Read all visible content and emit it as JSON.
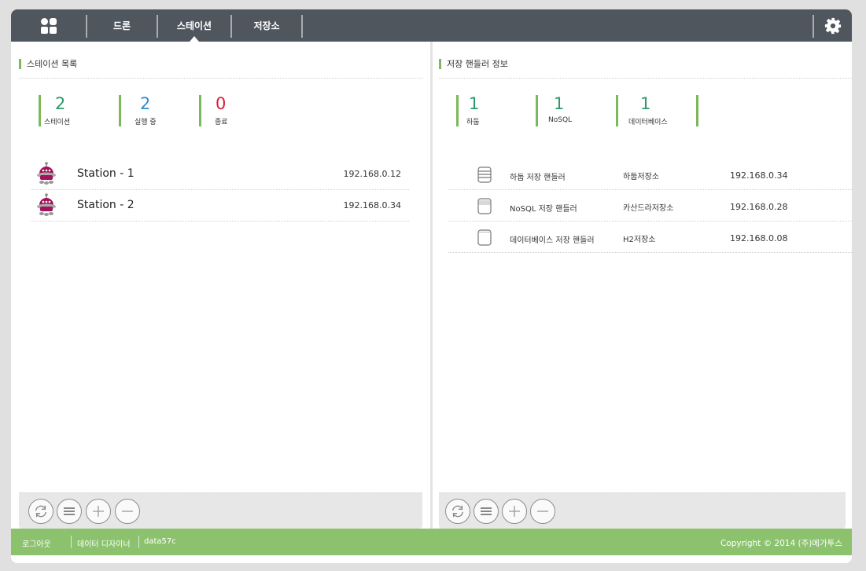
{
  "nav": {
    "home_icon": "grid-icon",
    "tabs": [
      {
        "label": "드론",
        "active": false
      },
      {
        "label": "스테이션",
        "active": true
      },
      {
        "label": "저장소",
        "active": false
      }
    ],
    "settings_icon": "gear-icon"
  },
  "left_panel": {
    "title": "스테이션 목록",
    "stats": [
      {
        "value": "2",
        "label": "스테이션",
        "color": "#2e9a6a"
      },
      {
        "value": "2",
        "label": "실행 중",
        "color": "#2a8fd6"
      },
      {
        "value": "0",
        "label": "종료",
        "color": "#d4203c"
      }
    ],
    "stations": [
      {
        "name": "Station - 1",
        "ip": "192.168.0.12",
        "icon": "robot-icon"
      },
      {
        "name": "Station - 2",
        "ip": "192.168.0.34",
        "icon": "robot-icon"
      }
    ]
  },
  "right_panel": {
    "title": "저장 핸들러 정보",
    "stats": [
      {
        "value": "1",
        "label": "하둡",
        "color": "#2e9a6a"
      },
      {
        "value": "1",
        "label": "NoSQL",
        "color": "#2e9a6a"
      },
      {
        "value": "1",
        "label": "데이터베이스",
        "color": "#2e9a6a"
      }
    ],
    "handlers": [
      {
        "name": "하둡 저장 핸들러",
        "storage": "하둡저장소",
        "ip": "192.168.0.34",
        "icon": "database-stack-icon"
      },
      {
        "name": "NoSQL 저장 핸들러",
        "storage": "카산드라저장소",
        "ip": "192.168.0.28",
        "icon": "database-lines-icon"
      },
      {
        "name": "데이터베이스 저장 핸들러",
        "storage": "H2저장소",
        "ip": "192.168.0.08",
        "icon": "database-empty-icon"
      }
    ]
  },
  "toolbar": {
    "buttons": [
      {
        "name": "refresh",
        "icon": "refresh-icon"
      },
      {
        "name": "list",
        "icon": "list-icon"
      },
      {
        "name": "add",
        "icon": "plus-icon"
      },
      {
        "name": "remove",
        "icon": "minus-icon"
      }
    ]
  },
  "footer": {
    "logout": "로그아웃",
    "role": "데이터 디자이너",
    "user": "data57c",
    "copyright": "Copyright © 2014 (주)메가투스"
  },
  "colors": {
    "topbar": "#50565e",
    "accent_green": "#7cb95a",
    "footer_green": "#8cc26e",
    "robot_magenta": "#a3125a"
  }
}
